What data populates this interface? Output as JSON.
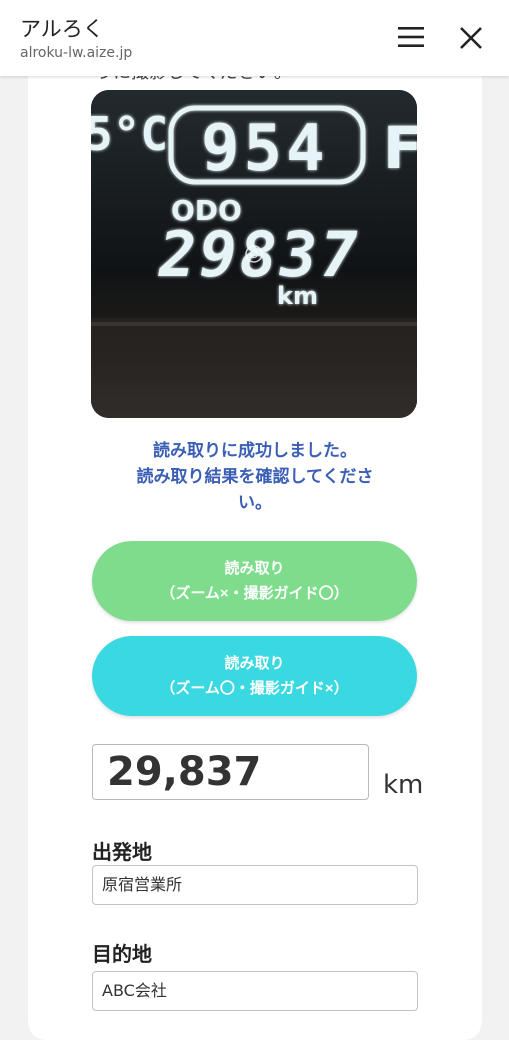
{
  "header": {
    "title": "アルろく",
    "url": "alroku-lw.aize.jp"
  },
  "capture": {
    "cut_off_text": "うに撮影してください。",
    "photo_readout": {
      "temperature": "5°C",
      "trip_display": "954",
      "odo_label": "ODO",
      "odo_display": "29837",
      "unit": "km"
    }
  },
  "result": {
    "success_line1": "読み取りに成功しました。",
    "success_line2": "読み取り結果を確認してくださ",
    "success_line3": "い。"
  },
  "buttons": {
    "zoom_off": {
      "line1": "読み取り",
      "line2": "（ズーム×・撮影ガイド〇）"
    },
    "zoom_on": {
      "line1": "読み取り",
      "line2": "（ズーム〇・撮影ガイド×）"
    }
  },
  "odometer": {
    "value": "29,837",
    "unit": "km"
  },
  "form": {
    "origin_label": "出発地",
    "origin_value": "原宿営業所",
    "destination_label": "目的地",
    "destination_value": "ABC会社"
  },
  "colors": {
    "accent_blue": "#3b5fb5",
    "button_green": "#7edc8c",
    "button_cyan": "#3ad8e0"
  }
}
